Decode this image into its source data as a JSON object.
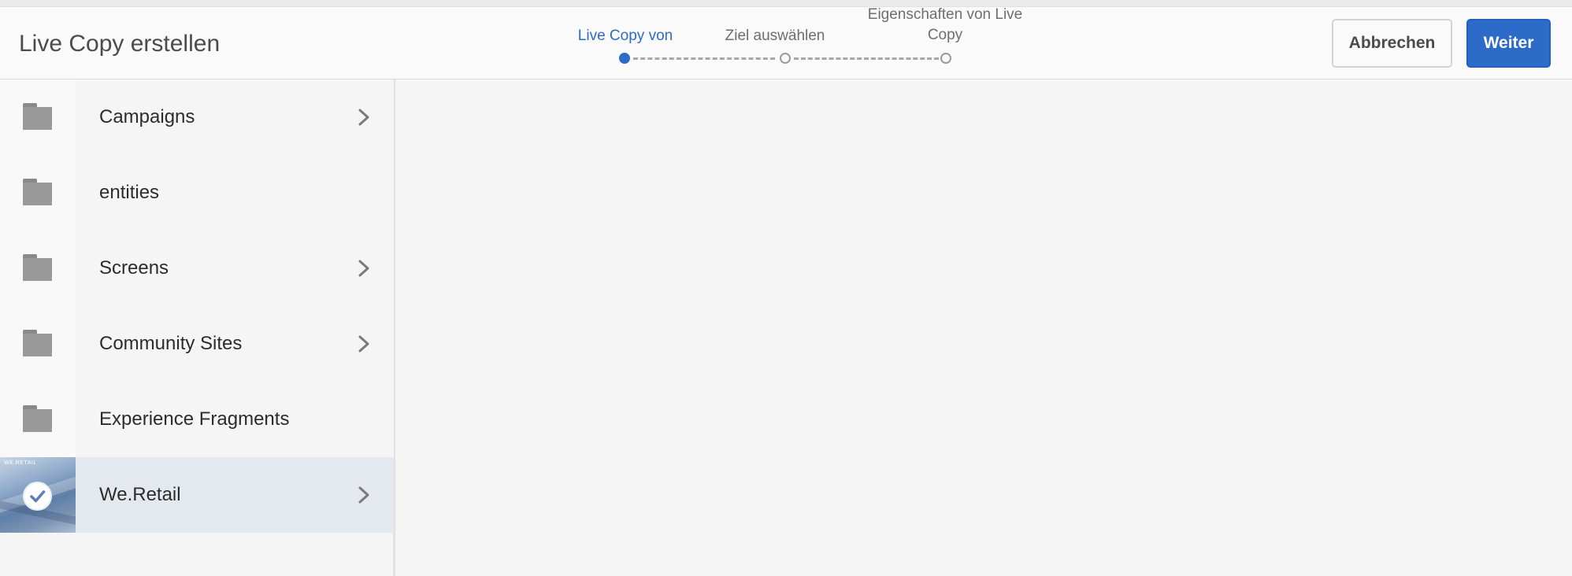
{
  "header": {
    "title": "Live Copy erstellen",
    "steps": [
      {
        "label": "Live Copy von",
        "state": "active"
      },
      {
        "label": "Ziel auswählen",
        "state": "pending"
      },
      {
        "label_line1": "Eigenschaften von Live",
        "label_line2": "Copy",
        "state": "pending"
      }
    ],
    "cancel_label": "Abbrechen",
    "next_label": "Weiter"
  },
  "sidebar": {
    "items": [
      {
        "label": "Campaigns",
        "icon": "folder-icon",
        "has_children": true
      },
      {
        "label": "entities",
        "icon": "folder-icon",
        "has_children": false
      },
      {
        "label": "Screens",
        "icon": "folder-icon",
        "has_children": true
      },
      {
        "label": "Community Sites",
        "icon": "folder-icon",
        "has_children": true
      },
      {
        "label": "Experience Fragments",
        "icon": "folder-icon",
        "has_children": false
      },
      {
        "label": "We.Retail",
        "icon": "site-thumbnail",
        "thumbnail_text": "WE.RETAIL",
        "has_children": true,
        "selected": true
      }
    ]
  },
  "colors": {
    "accent": "#2d6bc9",
    "selected_row": "#e4e8ef",
    "background": "#f5f5f5"
  }
}
